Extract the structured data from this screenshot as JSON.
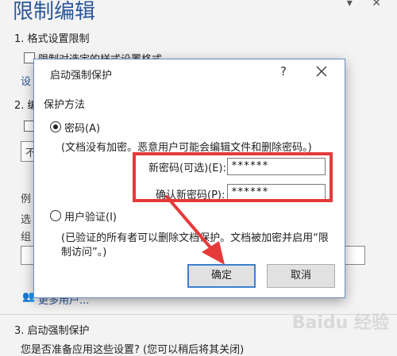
{
  "pane": {
    "title": "限制编辑",
    "section1": "1. 格式设置限制",
    "checkbox1_label": "限制对选定的样式设置格式",
    "link1": "设",
    "section2": "2. 编",
    "box_text": "不",
    "example": "例",
    "select": "选",
    "group": "组",
    "more_users": "更多用户...",
    "section3": "3. 启动强制保护",
    "question": "您是否准备应用这些设置? (您可以稍后将其关闭)"
  },
  "dialog": {
    "title": "启动强制保护",
    "help": "?",
    "group_label": "保护方法",
    "password_option": "密码(A)",
    "password_desc": "(文档没有加密。恶意用户可能会编辑文件和删除密码。)",
    "new_password_label": "新密码(可选)(E):",
    "new_password_value": "******",
    "confirm_password_label": "确认新密码(P):",
    "confirm_password_value": "******",
    "user_auth_option": "用户验证(I)",
    "user_auth_desc_1": "(已验证的所有者可以删除文档保护。文档被加密并启用“限",
    "user_auth_desc_2": "制访问”。)",
    "ok_label": "确定",
    "cancel_label": "取消"
  },
  "watermark": "Baidu 经验",
  "colors": {
    "accent": "#2b579a",
    "highlight": "#e53a3a",
    "arrow": "#e53a3a"
  }
}
